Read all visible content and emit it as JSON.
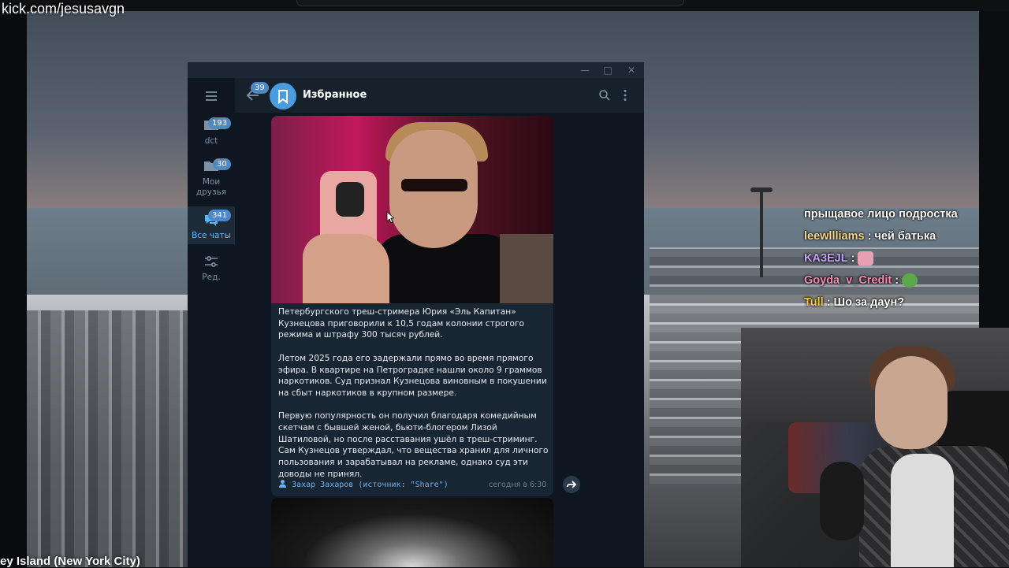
{
  "stream": {
    "channel_url": "kick.com/jesusavgn",
    "location_caption": "ey Island (New York City)"
  },
  "stream_chat": {
    "messages": [
      {
        "user": "",
        "text": "прыщавое лицо подростка",
        "user_color": "#ffffff"
      },
      {
        "user": "leewllliams",
        "text": "чей батька",
        "user_color": "#f5d78e"
      },
      {
        "user": "KA3EJL",
        "text": "",
        "user_color": "#c9a4f5",
        "emote": "pink-emote"
      },
      {
        "user": "Goyda_v_Credit",
        "text": "",
        "user_color": "#f58ab5",
        "emote": "pepe-emote"
      },
      {
        "user": "Tull",
        "text": "Шо за даун?",
        "user_color": "#f5c542"
      }
    ]
  },
  "telegram": {
    "folders": [
      {
        "label": "dct",
        "badge": "193",
        "icon": "folder-icon"
      },
      {
        "label": "Мои друзья",
        "badge": "30",
        "icon": "folder-icon"
      },
      {
        "label": "Все чаты",
        "badge": "341",
        "icon": "chats-icon",
        "active": true
      },
      {
        "label": "Ред.",
        "badge": "",
        "icon": "sliders-icon"
      }
    ],
    "header": {
      "back_badge": "39",
      "title": "Избранное"
    },
    "message": {
      "paragraphs": [
        "Петербургского треш-стримера Юрия «Эль Капитан» Кузнецова приговорили к 10,5 годам колонии строгого режима и штрафу 300 тысяч рублей.",
        "Летом 2025 года его задержали прямо во время прямого эфира. В квартире на Петроградке нашли около 9 граммов наркотиков. Суд признал Кузнецова виновным в покушении на сбыт наркотиков в крупном размере.",
        "Первую популярность он получил благодаря комедийным скетчам с бывшей женой, бьюти-блогером Лизой Шатиловой, но после расставания ушёл в треш-стриминг. Сам Кузнецов утверждал, что вещества хранил для личного пользования и зарабатывал на рекламе, однако суд эти доводы не принял."
      ],
      "author": "Захар Захаров (источник: \"Share\")",
      "time": "сегодня в 6:30"
    }
  },
  "colors": {
    "tg_bg": "#17212b",
    "tg_accent": "#5288c1",
    "link": "#6ab2f2"
  }
}
